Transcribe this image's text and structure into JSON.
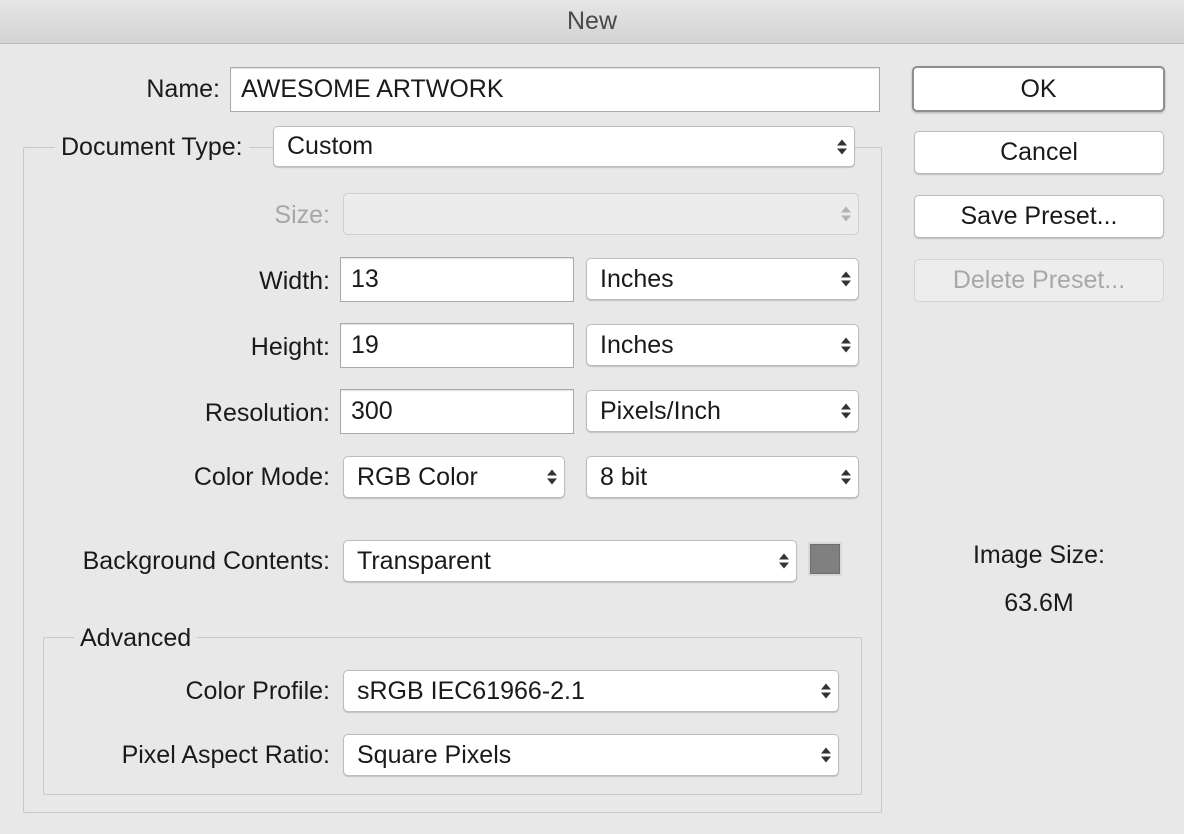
{
  "window": {
    "title": "New"
  },
  "name": {
    "label": "Name:",
    "value": "AWESOME ARTWORK"
  },
  "document_type": {
    "label": "Document Type:",
    "value": "Custom"
  },
  "size": {
    "label": "Size:",
    "value": ""
  },
  "width": {
    "label": "Width:",
    "value": "13",
    "unit": "Inches"
  },
  "height": {
    "label": "Height:",
    "value": "19",
    "unit": "Inches"
  },
  "resolution": {
    "label": "Resolution:",
    "value": "300",
    "unit": "Pixels/Inch"
  },
  "color_mode": {
    "label": "Color Mode:",
    "value": "RGB Color",
    "bit_depth": "8 bit"
  },
  "background_contents": {
    "label": "Background Contents:",
    "value": "Transparent",
    "swatch_color": "#808080"
  },
  "advanced": {
    "title": "Advanced",
    "color_profile": {
      "label": "Color Profile:",
      "value": "sRGB IEC61966-2.1"
    },
    "pixel_aspect_ratio": {
      "label": "Pixel Aspect Ratio:",
      "value": "Square Pixels"
    }
  },
  "buttons": {
    "ok": "OK",
    "cancel": "Cancel",
    "save_preset": "Save Preset...",
    "delete_preset": "Delete Preset..."
  },
  "image_size": {
    "label": "Image Size:",
    "value": "63.6M"
  }
}
